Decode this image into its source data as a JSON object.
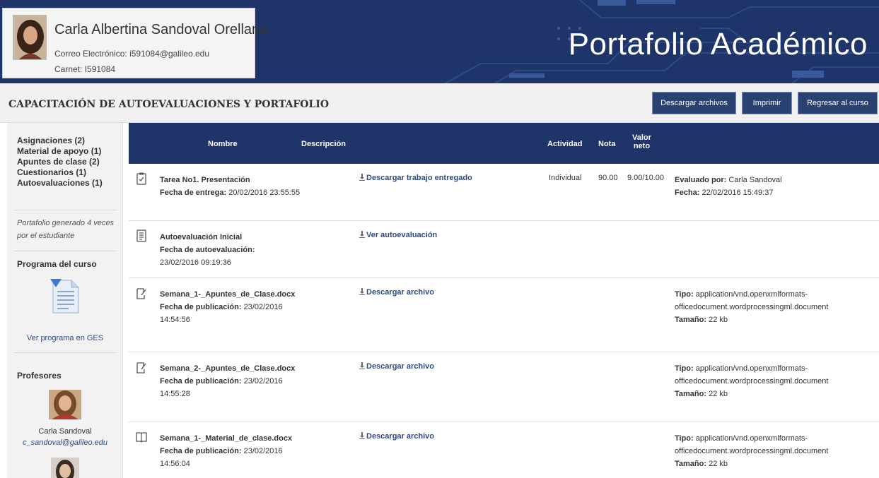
{
  "header": {
    "student_name": "Carla Albertina Sandoval Orellana",
    "email_label": "Correo Electrónico:",
    "email": "i591084@galileo.edu",
    "carnet_label": "Carnet:",
    "carnet": "I591084",
    "brand": "Portafolio Académico",
    "header_color": "#1f3468"
  },
  "course_bar": {
    "title": "CAPACITACIÓN DE AUTOEVALUACIONES Y PORTAFOLIO",
    "buttons": {
      "download": "Descargar archivos",
      "print": "Imprimir",
      "back": "Regresar al curso"
    }
  },
  "sidebar": {
    "links": [
      "Asignaciones (2)",
      "Material de apoyo (1)",
      "Apuntes de clase (2)",
      "Cuestionarios (1)",
      "Autoevaluaciones (1)"
    ],
    "generated_note": "Portafolio generado 4 veces por el estudiante",
    "program_heading": "Programa del curso",
    "program_link": "Ver programa en GES",
    "professors_heading": "Profesores",
    "professor_1_name": "Carla Sandoval",
    "professor_1_email": "c_sandoval@galileo.edu"
  },
  "table": {
    "headers": {
      "nombre": "Nombre",
      "descripcion": "Descripción",
      "actividad": "Actividad",
      "nota": "Nota",
      "valor_neto_1": "Valor",
      "valor_neto_2": "neto"
    },
    "rows": [
      {
        "icon": "clipboard-icon",
        "name": "Tarea No1. Presentación",
        "date_label": "Fecha de entrega:",
        "date": "20/02/2016 23:55:55",
        "link": "Descargar trabajo entregado",
        "actividad": "Individual",
        "nota": "90.00",
        "valor": "9.00/10.00",
        "detail_label_1": "Evaluado por:",
        "detail_value_1": "Carla Sandoval",
        "detail_label_2": "Fecha:",
        "detail_value_2": "22/02/2016 15:49:37"
      },
      {
        "icon": "form-icon",
        "name": "Autoevaluación Inicial",
        "date_label": "Fecha de autoevaluación:",
        "date": "23/02/2016 09:19:36",
        "link": "Ver autoevaluación"
      },
      {
        "icon": "note-icon",
        "name": "Semana_1-_Apuntes_de_Clase.docx",
        "date_label": "Fecha de publicación:",
        "date": "23/02/2016 14:54:56",
        "link": "Descargar archivo",
        "tipo_label": "Tipo:",
        "tipo": "application/vnd.openxmlformats-officedocument.wordprocessingml.document",
        "size_label": "Tamaño:",
        "size": "22 kb"
      },
      {
        "icon": "note-icon",
        "name": "Semana_2-_Apuntes_de_Clase.docx",
        "date_label": "Fecha de publicación:",
        "date": "23/02/2016 14:55:28",
        "link": "Descargar archivo",
        "tipo_label": "Tipo:",
        "tipo": "application/vnd.openxmlformats-officedocument.wordprocessingml.document",
        "size_label": "Tamaño:",
        "size": "22 kb"
      },
      {
        "icon": "book-icon",
        "name": "Semana_1-_Material_de_clase.docx",
        "date_label": "Fecha de publicación:",
        "date": "23/02/2016 14:56:04",
        "link": "Descargar archivo",
        "tipo_label": "Tipo:",
        "tipo": "application/vnd.openxmlformats-officedocument.wordprocessingml.document",
        "size_label": "Tamaño:",
        "size": "22 kb"
      }
    ]
  }
}
